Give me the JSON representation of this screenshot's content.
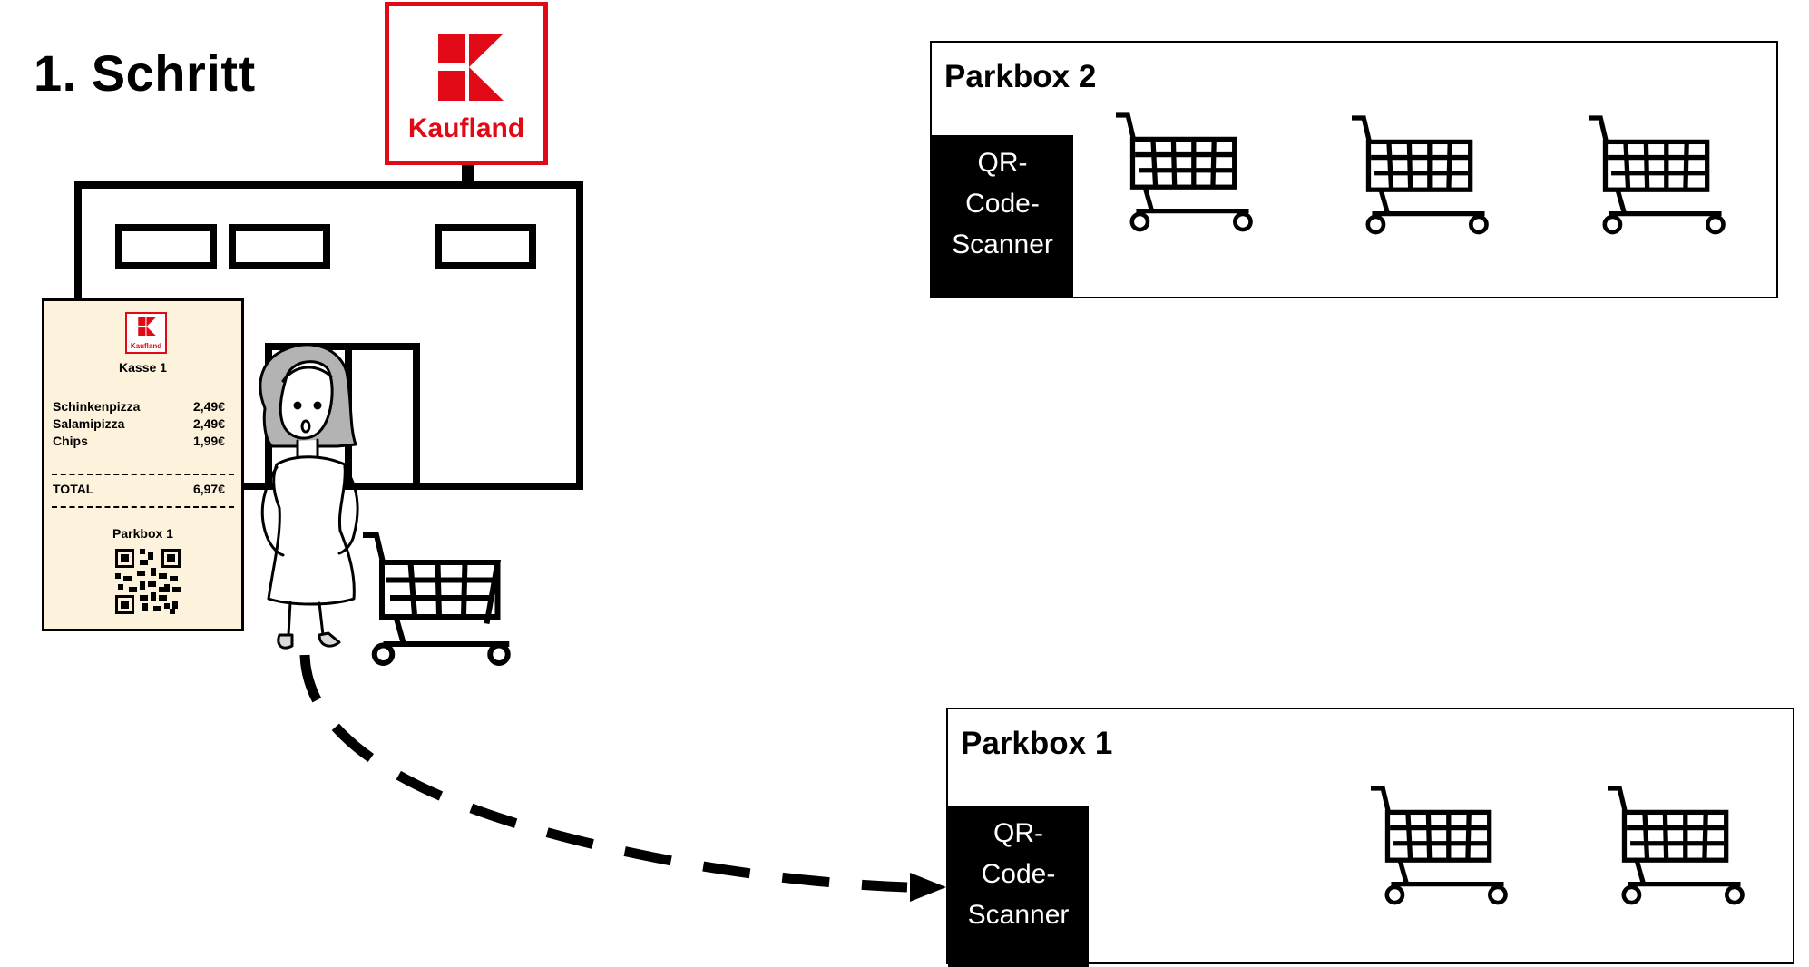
{
  "title": "1. Schritt",
  "store": {
    "brand": "Kaufland",
    "brand_color": "#e10915"
  },
  "receipt": {
    "brand": "Kaufland",
    "till": "Kasse 1",
    "items": [
      {
        "name": "Schinkenpizza",
        "price": "2,49€"
      },
      {
        "name": "Salamipizza",
        "price": "2,49€"
      },
      {
        "name": "Chips",
        "price": "1,99€"
      }
    ],
    "total_label": "TOTAL",
    "total_value": "6,97€",
    "parkbox": "Parkbox 1",
    "qr_icon": "qr-code-icon"
  },
  "parkboxes": [
    {
      "title": "Parkbox 2",
      "scanner": [
        "QR-",
        "Code-",
        "Scanner"
      ],
      "carts": 3
    },
    {
      "title": "Parkbox 1",
      "scanner": [
        "QR-",
        "Code-",
        "Scanner"
      ],
      "carts": 2
    }
  ],
  "icons": [
    "shopping-cart-icon",
    "woman-figure-icon",
    "store-building-icon",
    "dashed-arrow-icon"
  ]
}
